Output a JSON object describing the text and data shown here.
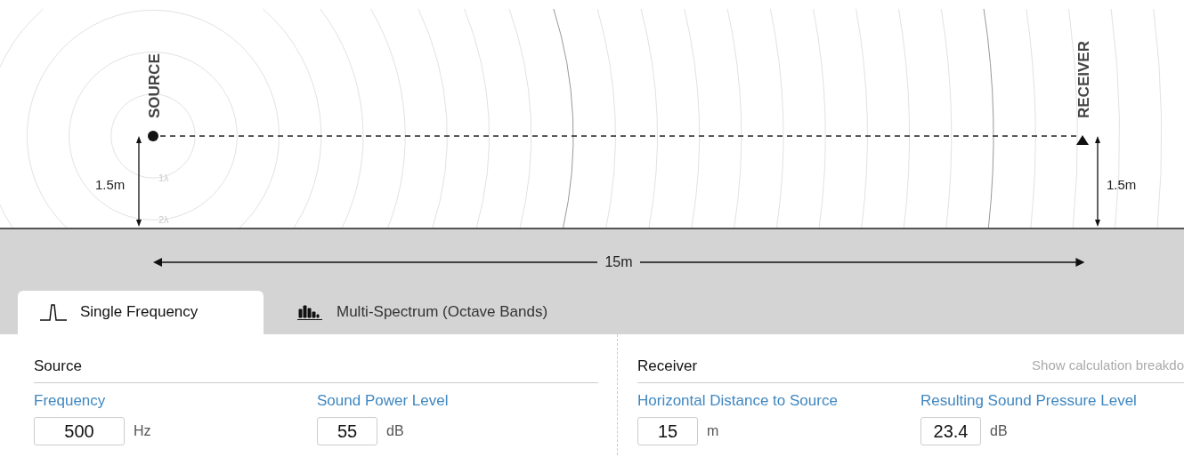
{
  "diagram": {
    "source_label": "SOURCE",
    "receiver_label": "RECEIVER",
    "source_height": "1.5m",
    "receiver_height": "1.5m",
    "ring_labels": [
      "1λ",
      "2λ"
    ],
    "distance": "15m"
  },
  "tabs": [
    {
      "label": "Single Frequency",
      "selected": true,
      "kind": "single"
    },
    {
      "label": "Multi-Spectrum (Octave Bands)",
      "selected": false,
      "kind": "spectrum"
    }
  ],
  "source": {
    "title": "Source",
    "fields": [
      {
        "label": "Frequency",
        "value": "500",
        "unit": "Hz"
      },
      {
        "label": "Sound Power Level",
        "value": "55",
        "unit": "dB"
      }
    ]
  },
  "receiver": {
    "title": "Receiver",
    "link": "Show calculation breakdo",
    "fields": [
      {
        "label": "Horizontal Distance to Source",
        "value": "15",
        "unit": "m"
      },
      {
        "label": "Resulting Sound Pressure Level",
        "value": "23.4",
        "unit": "dB"
      }
    ]
  }
}
